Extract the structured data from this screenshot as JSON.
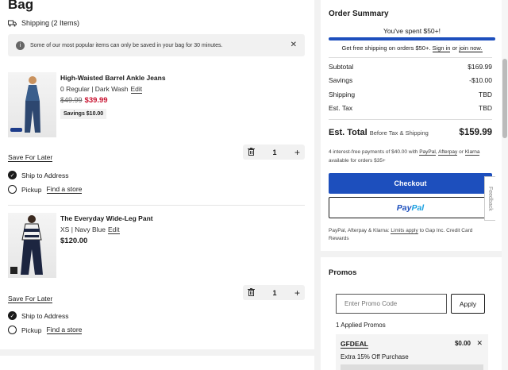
{
  "bag": {
    "title": "Bag",
    "shipping_label": "Shipping (2 Items)",
    "notice": "Some of our most popular items can only be saved in your bag for 30 minutes.",
    "items": [
      {
        "name": "High-Waisted Barrel Ankle Jeans",
        "variant": "0 Regular | Dark Wash",
        "edit": "Edit",
        "original_price": "$49.99",
        "sale_price": "$39.99",
        "savings": "Savings $10.00",
        "save_later": "Save For Later",
        "quantity": "1",
        "ship_to_address": "Ship to Address",
        "pickup": "Pickup",
        "find_store": "Find a store"
      },
      {
        "name": "The Everyday Wide-Leg Pant",
        "variant": "XS | Navy Blue",
        "edit": "Edit",
        "price": "$120.00",
        "save_later": "Save For Later",
        "quantity": "1",
        "ship_to_address": "Ship to Address",
        "pickup": "Pickup",
        "find_store": "Find a store"
      }
    ]
  },
  "summary": {
    "title": "Order Summary",
    "spent": "You've spent $50+!",
    "progress": 1.0,
    "free_ship_prefix": "Get free shipping on orders $50+.",
    "sign_in": "Sign in",
    "or": "or",
    "join_now": "join now.",
    "rows": [
      {
        "label": "Subtotal",
        "value": "$169.99"
      },
      {
        "label": "Savings",
        "value": "-$10.00"
      },
      {
        "label": "Shipping",
        "value": "TBD"
      },
      {
        "label": "Est. Tax",
        "value": "TBD"
      }
    ],
    "total_label": "Est. Total",
    "total_sub": "Before Tax & Shipping",
    "total_value": "$159.99",
    "installments_prefix": "4 interest-free payments of $40.00 with",
    "paypal_link": "PayPal",
    "afterpay_link": "Afterpay",
    "or_text": "or",
    "klarna_link": "Klarna",
    "installments_suffix": "available for orders $35+",
    "checkout": "Checkout",
    "paypal_button_1": "Pay",
    "paypal_button_2": "Pal",
    "pp_note_prefix": "PayPal, Afterpay & Klarna:",
    "pp_note_link": "Limits apply",
    "pp_note_suffix": "to Gap Inc. Credit Card Rewards",
    "feedback": "Feedback"
  },
  "promos": {
    "title": "Promos",
    "placeholder": "Enter Promo Code",
    "apply": "Apply",
    "applied_count": "1 Applied Promos",
    "code": "GFDEAL",
    "amount": "$0.00",
    "description": "Extra 15% Off Purchase"
  },
  "colors": {
    "accent": "#1d4fbd",
    "sale": "#c8102e"
  }
}
